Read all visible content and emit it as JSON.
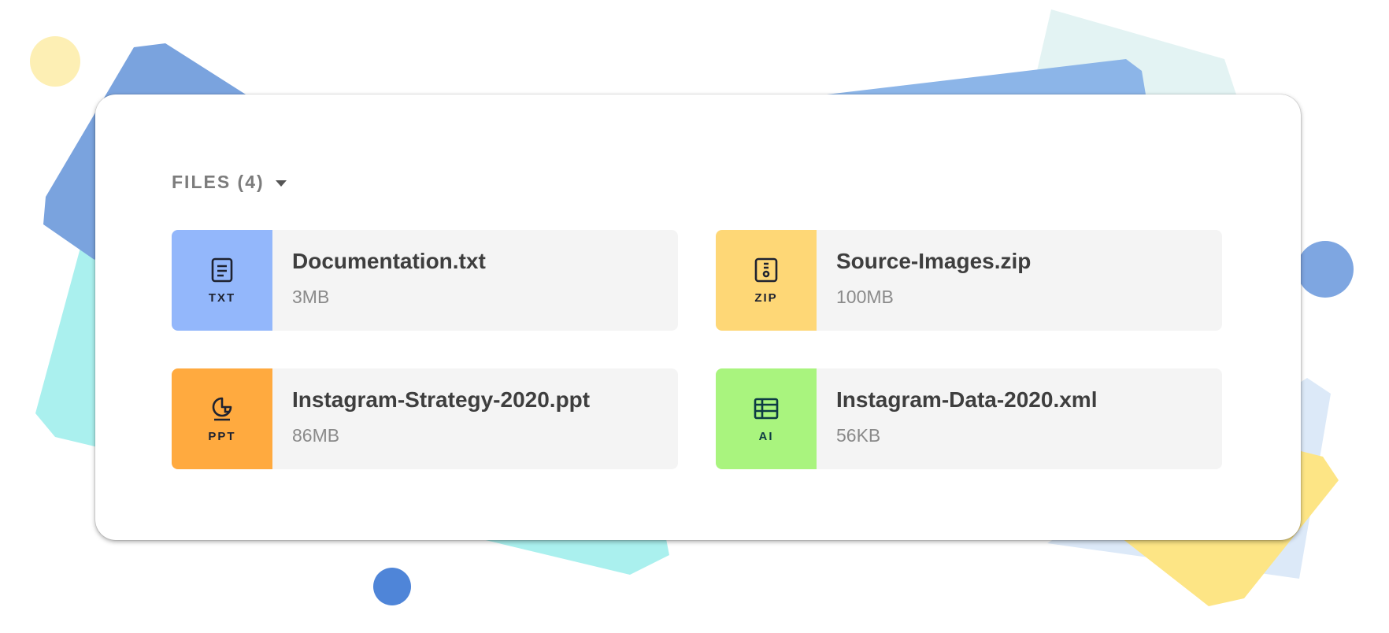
{
  "header": {
    "label": "FILES (4)",
    "caret_icon": "caret-down-icon"
  },
  "files": [
    {
      "name": "Documentation.txt",
      "size": "3MB",
      "ext": "TXT",
      "icon": "document-icon",
      "color": "#93b7fb"
    },
    {
      "name": "Source-Images.zip",
      "size": "100MB",
      "ext": "ZIP",
      "icon": "archive-icon",
      "color": "#fed776"
    },
    {
      "name": "Instagram-Strategy-2020.ppt",
      "size": "86MB",
      "ext": "PPT",
      "icon": "presentation-icon",
      "color": "#ffaa3f"
    },
    {
      "name": "Instagram-Data-2020.xml",
      "size": "56KB",
      "ext": "AI",
      "icon": "spreadsheet-icon",
      "color": "#a9f47e"
    }
  ]
}
